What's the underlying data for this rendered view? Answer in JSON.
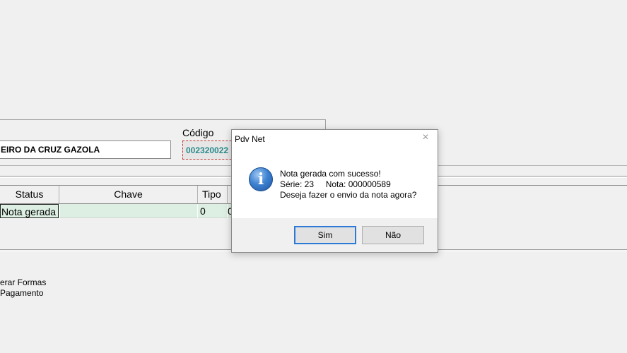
{
  "form": {
    "name_value": "EIRO DA CRUZ GAZOLA",
    "codigo_label": "Código",
    "codigo_value": "002320022"
  },
  "grid": {
    "headers": [
      "Status",
      "Chave",
      "Tipo"
    ],
    "rows": [
      {
        "status": "Nota gerada",
        "chave": "",
        "tipo": "0",
        "extra": "0"
      }
    ]
  },
  "links": {
    "line1": "erar Formas",
    "line2": "Pagamento"
  },
  "dialog": {
    "title": "Pdv Net",
    "close_symbol": "×",
    "icon_glyph": "i",
    "icon": "info-icon",
    "line1": "Nota gerada com sucesso!",
    "line2": "Série: 23     Nota: 000000589",
    "line3": "Deseja fazer o envio da nota agora?",
    "yes_label": "Sim",
    "no_label": "Não"
  },
  "colors": {
    "row_highlight": "#dcefe2",
    "codigo_text": "#2a8a8a",
    "codigo_border": "#c0302e",
    "info_icon": "#3f83d1"
  }
}
